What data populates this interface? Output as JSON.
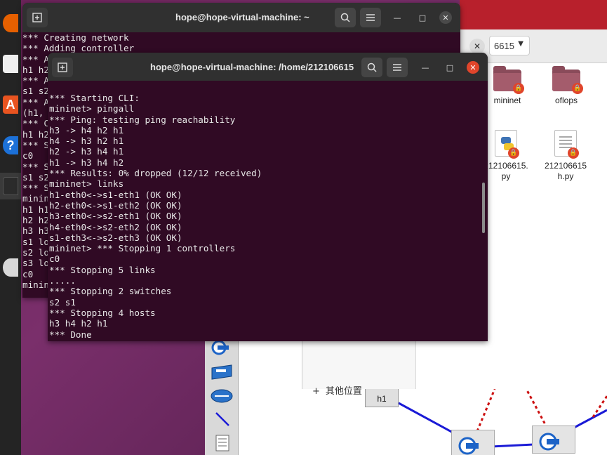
{
  "dock": {
    "icons": [
      "firefox-icon",
      "files-icon",
      "ubuntu-software-icon",
      "help-icon",
      "terminal-icon",
      "dvd-icon"
    ],
    "colors": {
      "firefox": "#e66000",
      "software": "#e95420",
      "help": "#1c71d8"
    }
  },
  "back_terminal": {
    "title": "hope@hope-virtual-machine: ~",
    "lines": [
      "*** Creating network",
      "*** Adding controller",
      "*** A",
      "h1 h2",
      "*** A",
      "s1 s2",
      "*** A",
      "(h1,",
      "*** C",
      "h1 h2",
      "*** S",
      "c0",
      "*** S",
      "s1 s2",
      "*** S",
      "minin",
      "h1 h1",
      "h2 h2",
      "h3 h3",
      "s1 lo",
      "s2 lo",
      "s3 lo",
      "c0",
      "minin"
    ]
  },
  "front_terminal": {
    "title": "hope@hope-virtual-machine: /home/212106615",
    "lines": [
      "*** Starting CLI:",
      "mininet> pingall",
      "*** Ping: testing ping reachability",
      "h3 -> h4 h2 h1",
      "h4 -> h3 h2 h1",
      "h2 -> h3 h4 h1",
      "h1 -> h3 h4 h2",
      "*** Results: 0% dropped (12/12 received)",
      "mininet> links",
      "h1-eth0<->s1-eth1 (OK OK)",
      "h2-eth0<->s1-eth2 (OK OK)",
      "h3-eth0<->s2-eth1 (OK OK)",
      "h4-eth0<->s2-eth2 (OK OK)",
      "s1-eth3<->s2-eth3 (OK OK)",
      "mininet> *** Stopping 1 controllers",
      "c0",
      "*** Stopping 5 links",
      ".....",
      "*** Stopping 2 switches",
      "s2 s1",
      "*** Stopping 4 hosts",
      "h3 h4 h2 h1",
      "*** Done"
    ]
  },
  "file_manager": {
    "path_button": "6615",
    "sidebar": {
      "other_locations": "其他位置"
    },
    "items": [
      {
        "name": "mininet",
        "type": "folder"
      },
      {
        "name": "oflops",
        "type": "folder"
      },
      {
        "name": "212106615.\npy",
        "type": "python"
      },
      {
        "name": "212106615\nh.py",
        "type": "text"
      }
    ]
  },
  "miniedit": {
    "host_label": "h1"
  }
}
